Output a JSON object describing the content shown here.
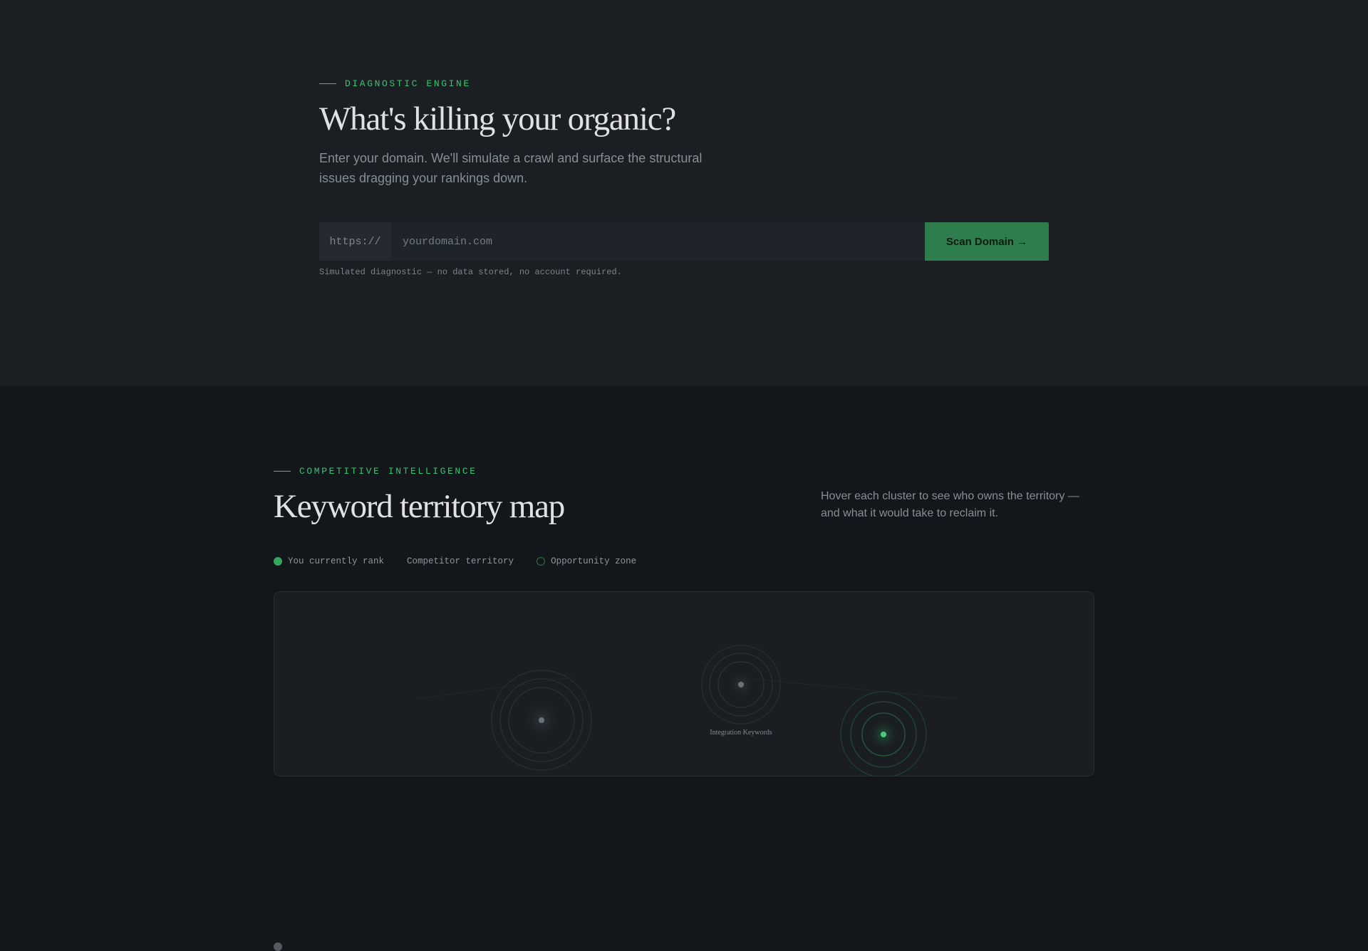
{
  "diagnostic": {
    "eyebrow": "DIAGNOSTIC ENGINE",
    "title": "What's killing your organic?",
    "lede": "Enter your domain. We'll simulate a crawl and surface the structural issues dragging your rankings down.",
    "form": {
      "prefix": "https://",
      "placeholder": "yourdomain.com",
      "value": "",
      "button_label": "Scan Domain →"
    },
    "disclaimer": "Simulated diagnostic — no data stored, no account required."
  },
  "competitive": {
    "eyebrow": "COMPETITIVE INTELLIGENCE",
    "title": "Keyword territory map",
    "side_note": "Hover each cluster to see who owns the territory — and what it would take to reclaim it.",
    "legend": [
      {
        "label": "You currently rank",
        "type": "rank"
      },
      {
        "label": "Competitor territory",
        "type": "competitor"
      },
      {
        "label": "Opportunity zone",
        "type": "opportunity"
      }
    ],
    "clusters": [
      {
        "label": "",
        "type": "competitor"
      },
      {
        "label": "Integration Keywords",
        "type": "competitor"
      },
      {
        "label": "",
        "type": "rank"
      }
    ]
  },
  "colors": {
    "accent": "#37c36e",
    "button": "#2e7d4c",
    "rank": "#36a65e",
    "competitor": "#535a62",
    "opportunity": "#2f7a4c"
  }
}
